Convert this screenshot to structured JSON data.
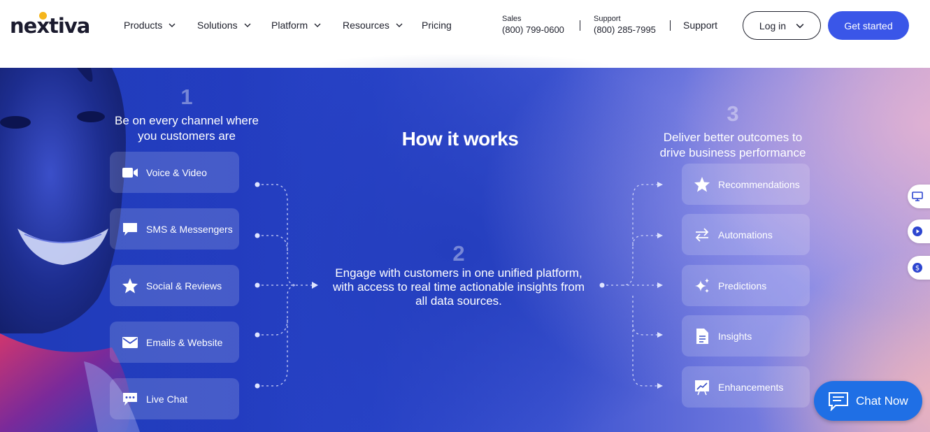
{
  "brand": {
    "name": "nextiva",
    "accent": "#3a56e8",
    "logo_dot_color": "#f5b51b"
  },
  "nav": {
    "items": [
      {
        "label": "Products",
        "has_dropdown": true
      },
      {
        "label": "Solutions",
        "has_dropdown": true
      },
      {
        "label": "Platform",
        "has_dropdown": true
      },
      {
        "label": "Resources",
        "has_dropdown": true
      },
      {
        "label": "Pricing",
        "has_dropdown": false
      }
    ],
    "sales_label": "Sales",
    "sales_phone": "(800) 799-0600",
    "support_label": "Support",
    "support_phone": "(800) 285-7995",
    "support_link": "Support",
    "login_label": "Log in",
    "get_started_label": "Get started"
  },
  "hero": {
    "title": "How it works",
    "step1": {
      "number": "1",
      "title_line1": "Be on every channel where",
      "title_line2": "you customers are"
    },
    "step2": {
      "number": "2",
      "text_line1": "Engage with customers in one unified platform,",
      "text_line2": "with access to real time actionable insights from",
      "text_line3": "all data sources."
    },
    "step3": {
      "number": "3",
      "title_line1": "Deliver better outcomes to",
      "title_line2": "drive business performance"
    },
    "channels": [
      {
        "label": "Voice & Video",
        "icon": "video-camera-icon"
      },
      {
        "label": "SMS & Messengers",
        "icon": "chat-bubble-icon"
      },
      {
        "label": "Social & Reviews",
        "icon": "star-icon"
      },
      {
        "label": "Emails & Website",
        "icon": "envelope-icon"
      },
      {
        "label": "Live Chat",
        "icon": "chat-dots-icon"
      }
    ],
    "outcomes": [
      {
        "label": "Recommendations",
        "icon": "star-icon"
      },
      {
        "label": "Automations",
        "icon": "swap-arrows-icon"
      },
      {
        "label": "Predictions",
        "icon": "sparkles-icon"
      },
      {
        "label": "Insights",
        "icon": "document-icon"
      },
      {
        "label": "Enhancements",
        "icon": "chart-board-icon"
      }
    ]
  },
  "side_tabs": [
    "monitor-icon",
    "play-icon",
    "dollar-icon"
  ],
  "chat": {
    "label": "Chat Now",
    "color": "#1f6fe5"
  }
}
